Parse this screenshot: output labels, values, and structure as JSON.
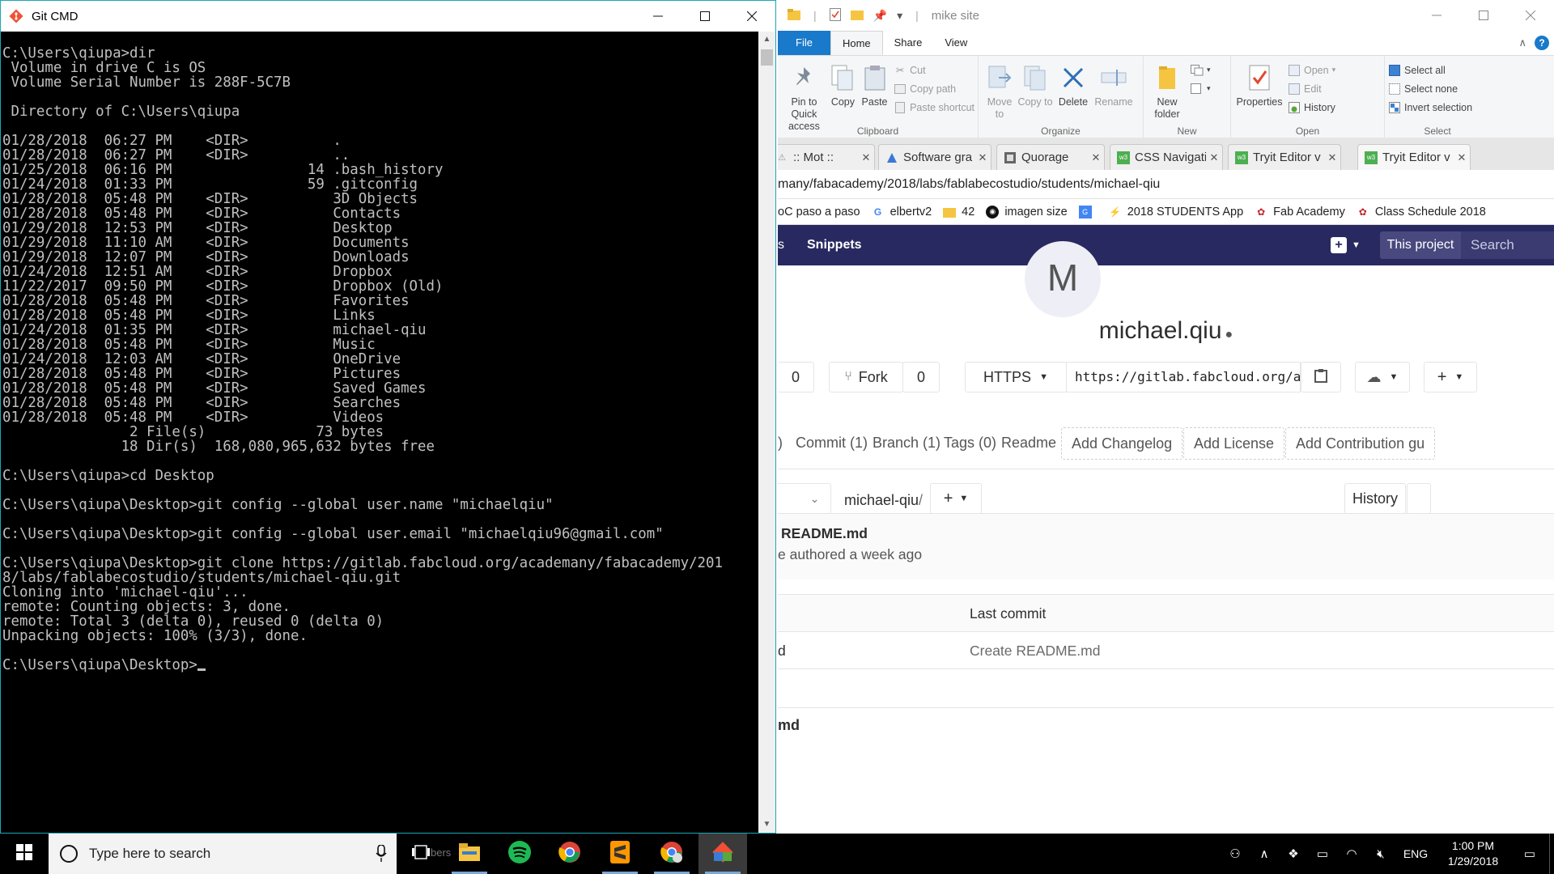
{
  "cmd": {
    "title": "Git CMD",
    "lines": [
      "C:\\Users\\qiupa>dir",
      " Volume in drive C is OS",
      " Volume Serial Number is 288F-5C7B",
      "",
      " Directory of C:\\Users\\qiupa",
      "",
      "01/28/2018  06:27 PM    <DIR>          .",
      "01/28/2018  06:27 PM    <DIR>          ..",
      "01/25/2018  06:16 PM                14 .bash_history",
      "01/24/2018  01:33 PM                59 .gitconfig",
      "01/28/2018  05:48 PM    <DIR>          3D Objects",
      "01/28/2018  05:48 PM    <DIR>          Contacts",
      "01/29/2018  12:53 PM    <DIR>          Desktop",
      "01/29/2018  11:10 AM    <DIR>          Documents",
      "01/29/2018  12:07 PM    <DIR>          Downloads",
      "01/24/2018  12:51 AM    <DIR>          Dropbox",
      "11/22/2017  09:50 PM    <DIR>          Dropbox (Old)",
      "01/28/2018  05:48 PM    <DIR>          Favorites",
      "01/28/2018  05:48 PM    <DIR>          Links",
      "01/24/2018  01:35 PM    <DIR>          michael-qiu",
      "01/28/2018  05:48 PM    <DIR>          Music",
      "01/24/2018  12:03 AM    <DIR>          OneDrive",
      "01/28/2018  05:48 PM    <DIR>          Pictures",
      "01/28/2018  05:48 PM    <DIR>          Saved Games",
      "01/28/2018  05:48 PM    <DIR>          Searches",
      "01/28/2018  05:48 PM    <DIR>          Videos",
      "               2 File(s)             73 bytes",
      "              18 Dir(s)  168,080,965,632 bytes free",
      "",
      "C:\\Users\\qiupa>cd Desktop",
      "",
      "C:\\Users\\qiupa\\Desktop>git config --global user.name \"michaelqiu\"",
      "",
      "C:\\Users\\qiupa\\Desktop>git config --global user.email \"michaelqiu96@gmail.com\"",
      "",
      "C:\\Users\\qiupa\\Desktop>git clone https://gitlab.fabcloud.org/academany/fabacademy/201",
      "8/labs/fablabecostudio/students/michael-qiu.git",
      "Cloning into 'michael-qiu'...",
      "remote: Counting objects: 3, done.",
      "remote: Total 3 (delta 0), reused 0 (delta 0)",
      "Unpacking objects: 100% (3/3), done.",
      "",
      "C:\\Users\\qiupa\\Desktop>"
    ]
  },
  "explorer": {
    "title": "mike site",
    "tabs": {
      "file": "File",
      "home": "Home",
      "share": "Share",
      "view": "View"
    },
    "clipboard": {
      "pin": "Pin to Quick access",
      "copy": "Copy",
      "paste": "Paste",
      "cut": "Cut",
      "copy_path": "Copy path",
      "paste_shortcut": "Paste shortcut",
      "label": "Clipboard"
    },
    "organize": {
      "move_to": "Move to",
      "copy_to": "Copy to",
      "delete": "Delete",
      "rename": "Rename",
      "label": "Organize"
    },
    "new": {
      "new_folder": "New folder",
      "label": "New"
    },
    "open": {
      "properties": "Properties",
      "open": "Open",
      "edit": "Edit",
      "history": "History",
      "label": "Open"
    },
    "select": {
      "select_all": "Select all",
      "select_none": "Select none",
      "invert": "Invert selection",
      "label": "Select"
    }
  },
  "chrome": {
    "tabs": [
      {
        "title": ":: Mot ::"
      },
      {
        "title": "Software gra"
      },
      {
        "title": "Quorage"
      },
      {
        "title": "CSS Navigati"
      },
      {
        "title": "Tryit Editor v"
      },
      {
        "title": "Tryit Editor v"
      }
    ],
    "url": "many/fabacademy/2018/labs/fablabecostudio/students/michael-qiu",
    "bookmarks": [
      "oC paso a paso",
      "elbertv2",
      "42",
      "imagen size",
      "",
      "2018 STUDENTS App",
      "Fab Academy",
      "Class Schedule 2018"
    ]
  },
  "gitlab": {
    "nav": {
      "partial": "s",
      "snippets": "Snippets",
      "scope": "This project",
      "search_placeholder": "Search"
    },
    "avatar_letter": "M",
    "project_name": "michael.qiu",
    "star_count": "0",
    "fork_label": "Fork",
    "fork_count": "0",
    "protocol": "HTTPS",
    "clone_url": "https://gitlab.fabcloud.org/aca",
    "stats": {
      "partial": ")",
      "commit": "Commit (1)",
      "branch": "Branch (1)",
      "tags": "Tags (0)",
      "readme": "Readme",
      "add_changelog": "Add Changelog",
      "add_license": "Add License",
      "add_contribution": "Add Contribution gu"
    },
    "tree": {
      "path": "michael-qiu",
      "slash": "/",
      "history": "History"
    },
    "last_commit": {
      "title": "README.md",
      "meta": "e authored a week ago"
    },
    "table": {
      "last_commit_header": "Last commit",
      "row_name_partial": "d",
      "row_commit": "Create README.md",
      "bottom_partial": "md"
    }
  },
  "taskbar": {
    "search_placeholder": "Type here to search",
    "peek_text": "bers",
    "lang": "ENG",
    "time": "1:00 PM",
    "date": "1/29/2018"
  }
}
